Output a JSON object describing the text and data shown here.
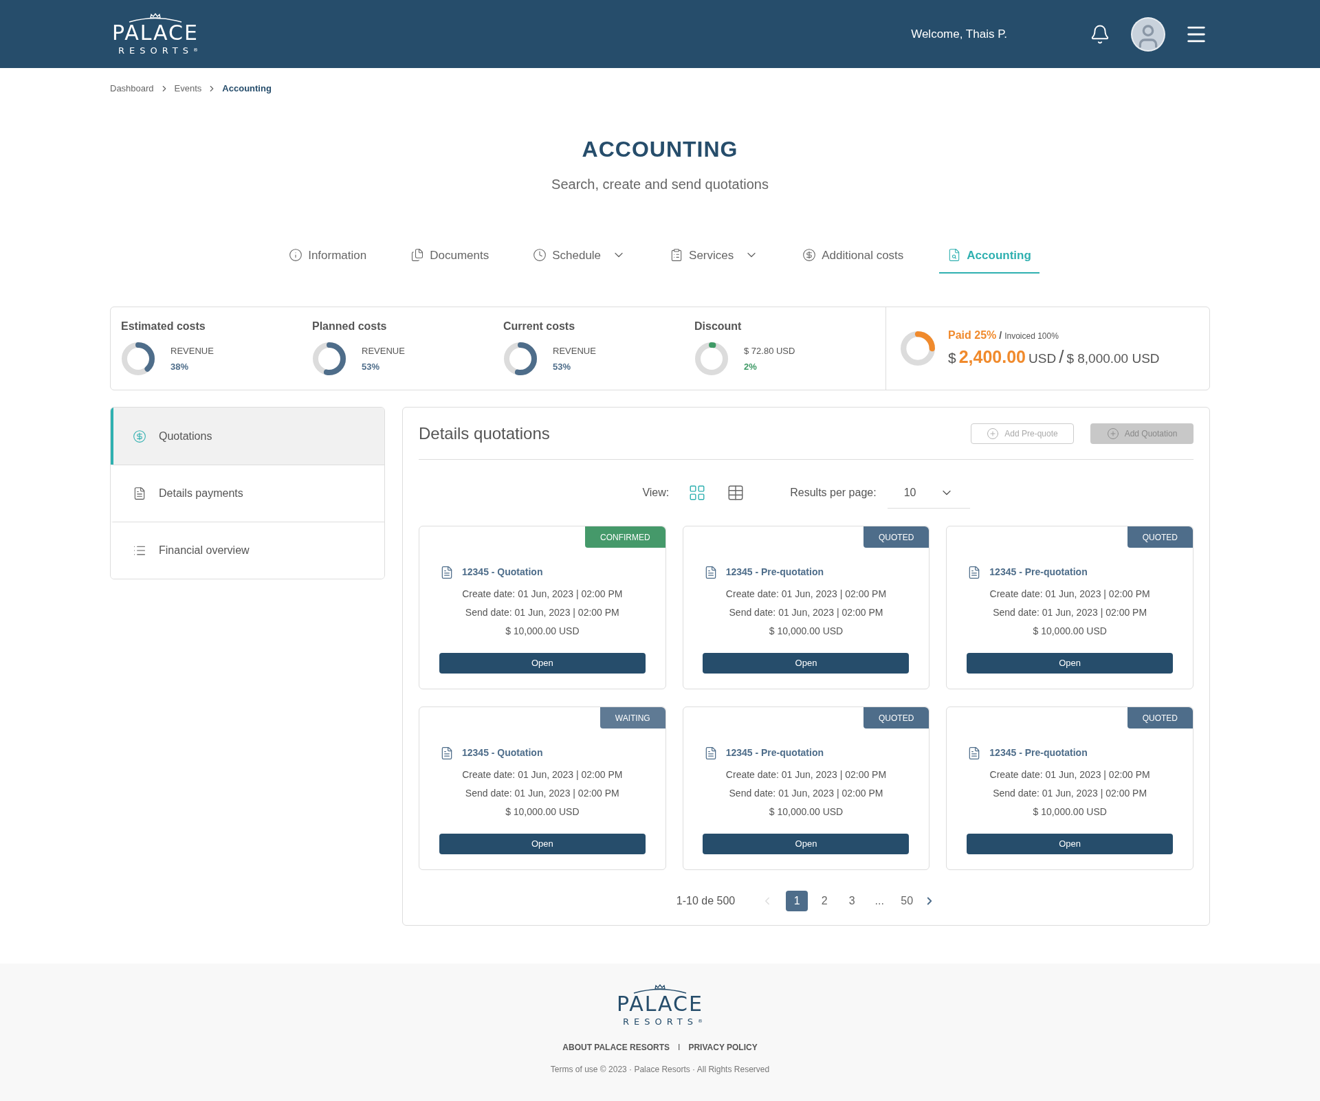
{
  "header": {
    "logo": {
      "word": "PALACE",
      "sub": "RESORTS",
      "mark": "®"
    },
    "welcome": "Welcome, Thais P."
  },
  "breadcrumb": [
    {
      "label": "Dashboard",
      "selected": false
    },
    {
      "label": "Events",
      "selected": false
    },
    {
      "label": "Accounting",
      "selected": true
    }
  ],
  "page": {
    "title": "ACCOUNTING",
    "subtitle": "Search, create and send quotations"
  },
  "tabs": [
    {
      "label": "Information",
      "selected": false,
      "has_menu": false
    },
    {
      "label": "Documents",
      "selected": false,
      "has_menu": false
    },
    {
      "label": "Schedule",
      "selected": false,
      "has_menu": true
    },
    {
      "label": "Services",
      "selected": false,
      "has_menu": true
    },
    {
      "label": "Additional costs",
      "selected": false,
      "has_menu": false
    },
    {
      "label": "Accounting",
      "selected": true,
      "has_menu": false
    }
  ],
  "summary": {
    "metrics": [
      {
        "title": "Estimated costs",
        "label": "REVENUE",
        "value": "38%",
        "level": 0.38,
        "color": "#4e6d8a"
      },
      {
        "title": "Planned costs",
        "label": "REVENUE",
        "value": "53%",
        "level": 0.53,
        "color": "#4e6d8a"
      },
      {
        "title": "Current costs",
        "label": "REVENUE",
        "value": "53%",
        "level": 0.53,
        "color": "#4e6d8a"
      },
      {
        "title": "Discount",
        "label": "$ 72.80 USD",
        "value": "2%",
        "level": 0.02,
        "color": "#3f9a66"
      }
    ],
    "paid": {
      "label": "Paid 25%",
      "separator": "/",
      "invoiced": "Invoiced 100%",
      "level": 0.25,
      "currency": "$",
      "amount": "2,400.00",
      "unit": "USD",
      "slash": "/",
      "total": "$ 8,000.00 USD"
    }
  },
  "sidebar": {
    "items": [
      {
        "label": "Quotations",
        "selected": true
      },
      {
        "label": "Details payments",
        "selected": false
      },
      {
        "label": "Financial overview",
        "selected": false
      }
    ]
  },
  "details": {
    "title": "Details quotations",
    "buttons": [
      "Add Pre-quote",
      "Add Quotation"
    ],
    "view_label": "View:",
    "views": [
      {
        "kind": "grid",
        "selected": true
      },
      {
        "kind": "list",
        "selected": false
      }
    ],
    "results_label": "Results per page:",
    "results_value": "10",
    "cards": [
      {
        "status": "CONFIRMED",
        "color": "#45996a",
        "title": "12345 - Quotation",
        "create": "Create date: 01 Jun, 2023 | 02:00 PM",
        "send": "Send date: 01 Jun, 2023 | 02:00 PM",
        "amount": "$ 10,000.00 USD",
        "button": "Open"
      },
      {
        "status": "QUOTED",
        "color": "#4e6d8a",
        "title": "12345 - Pre-quotation",
        "create": "Create date: 01 Jun, 2023 | 02:00 PM",
        "send": "Send date: 01 Jun, 2023 | 02:00 PM",
        "amount": "$ 10,000.00 USD",
        "button": "Open"
      },
      {
        "status": "QUOTED",
        "color": "#4e6d8a",
        "title": "12345 - Pre-quotation",
        "create": "Create date: 01 Jun, 2023 | 02:00 PM",
        "send": "Send date: 01 Jun, 2023 | 02:00 PM",
        "amount": "$ 10,000.00 USD",
        "button": "Open"
      },
      {
        "status": "WAITING",
        "color": "#5f7a94",
        "title": "12345 - Quotation",
        "create": "Create date: 01 Jun, 2023 | 02:00 PM",
        "send": "Send date: 01 Jun, 2023 | 02:00 PM",
        "amount": "$ 10,000.00 USD",
        "button": "Open"
      },
      {
        "status": "QUOTED",
        "color": "#4e6d8a",
        "title": "12345 - Pre-quotation",
        "create": "Create date: 01 Jun, 2023 | 02:00 PM",
        "send": "Send date: 01 Jun, 2023 | 02:00 PM",
        "amount": "$ 10,000.00 USD",
        "button": "Open"
      },
      {
        "status": "QUOTED",
        "color": "#4e6d8a",
        "title": "12345 - Pre-quotation",
        "create": "Create date: 01 Jun, 2023 | 02:00 PM",
        "send": "Send date: 01 Jun, 2023 | 02:00 PM",
        "amount": "$ 10,000.00 USD",
        "button": "Open"
      }
    ],
    "pagination": {
      "range": "1-10 de 500",
      "prev_disabled": true,
      "pages": [
        {
          "label": "1",
          "selected": true
        },
        {
          "label": "2",
          "selected": false
        },
        {
          "label": "3",
          "selected": false
        },
        {
          "label": "...",
          "selected": false
        },
        {
          "label": "50",
          "selected": false
        }
      ]
    }
  },
  "footer": {
    "logo": {
      "word": "PALACE",
      "sub": "RESORTS",
      "mark": "®"
    },
    "links": [
      "ABOUT PALACE RESORTS",
      "PRIVACY POLICY"
    ],
    "separator": "I",
    "copyright": "Terms of use © 2023 · Palace Resorts · All Rights Reserved"
  }
}
